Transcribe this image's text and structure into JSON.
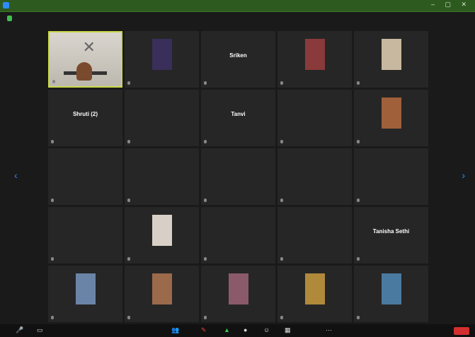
{
  "window": {
    "title": "",
    "controls": "– ▢ ✕"
  },
  "header": {
    "view_label": ""
  },
  "grid": {
    "tiles": [
      {
        "type": "video",
        "name": "",
        "caption": ""
      },
      {
        "type": "photo",
        "name": "",
        "caption": "",
        "img_color": "#3a2f5a"
      },
      {
        "type": "name",
        "name": "Sriken",
        "caption": ""
      },
      {
        "type": "photo",
        "name": "",
        "caption": "",
        "img_color": "#8a3a3a"
      },
      {
        "type": "photo",
        "name": "",
        "caption": "",
        "img_color": "#c9b8a0"
      },
      {
        "type": "name",
        "name": "Shruti (2)",
        "caption": ""
      },
      {
        "type": "name",
        "name": "",
        "caption": ""
      },
      {
        "type": "name",
        "name": "Tanvi",
        "caption": ""
      },
      {
        "type": "name",
        "name": "",
        "caption": ""
      },
      {
        "type": "photo",
        "name": "",
        "caption": "",
        "img_color": "#a0603a"
      },
      {
        "type": "name",
        "name": "",
        "caption": ""
      },
      {
        "type": "name",
        "name": "",
        "caption": ""
      },
      {
        "type": "name",
        "name": "",
        "caption": ""
      },
      {
        "type": "name",
        "name": "",
        "caption": ""
      },
      {
        "type": "name",
        "name": "",
        "caption": ""
      },
      {
        "type": "name",
        "name": "",
        "caption": ""
      },
      {
        "type": "photo",
        "name": "",
        "caption": "",
        "img_color": "#d8d0c6"
      },
      {
        "type": "name",
        "name": "",
        "caption": ""
      },
      {
        "type": "name",
        "name": "",
        "caption": ""
      },
      {
        "type": "name",
        "name": "Tanisha Sethi",
        "caption": ""
      },
      {
        "type": "photo",
        "name": "",
        "caption": "",
        "img_color": "#6a84a8"
      },
      {
        "type": "photo",
        "name": "",
        "caption": "",
        "img_color": "#9a6a4a"
      },
      {
        "type": "photo",
        "name": "",
        "caption": "",
        "img_color": "#8a5a6a"
      },
      {
        "type": "photo",
        "name": "",
        "caption": "",
        "img_color": "#b08a3a"
      },
      {
        "type": "photo",
        "name": "",
        "caption": "",
        "img_color": "#4a7aa0"
      }
    ]
  },
  "toolbar": {
    "items": [
      {
        "icon": "mute-icon",
        "glyph": "🎤",
        "label": ""
      },
      {
        "icon": "video-icon",
        "glyph": "▭",
        "label": ""
      },
      {
        "icon": "participants-icon",
        "glyph": "👥",
        "label": ""
      },
      {
        "icon": "chat-icon",
        "glyph": "✎",
        "label": ""
      },
      {
        "icon": "share-screen-icon",
        "glyph": "▲",
        "label": ""
      },
      {
        "icon": "record-icon",
        "glyph": "●",
        "label": ""
      },
      {
        "icon": "reactions-icon",
        "glyph": "☺",
        "label": ""
      },
      {
        "icon": "apps-icon",
        "glyph": "▦",
        "label": ""
      },
      {
        "icon": "more-icon",
        "glyph": "⋯",
        "label": ""
      }
    ],
    "end_label": ""
  }
}
